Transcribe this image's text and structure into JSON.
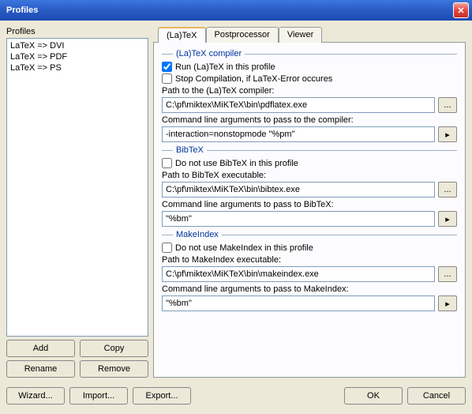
{
  "window": {
    "title": "Profiles"
  },
  "sidebar": {
    "label": "Profiles",
    "items": [
      "LaTeX => DVI",
      "LaTeX => PDF",
      "LaTeX => PS"
    ],
    "buttons": {
      "add": "Add",
      "copy": "Copy",
      "rename": "Rename",
      "remove": "Remove"
    }
  },
  "tabs": {
    "latex": "(La)TeX",
    "postprocessor": "Postprocessor",
    "viewer": "Viewer"
  },
  "latex_group": {
    "heading": "(La)TeX compiler",
    "run_chk": "Run (La)TeX in this profile",
    "run_checked": true,
    "stop_chk": "Stop Compilation, if LaTeX-Error occures",
    "stop_checked": false,
    "path_lbl": "Path to the (La)TeX compiler:",
    "path_val": "C:\\pf\\miktex\\MiKTeX\\bin\\pdflatex.exe",
    "args_lbl": "Command line arguments to pass to the compiler:",
    "args_val": "-interaction=nonstopmode \"%pm\""
  },
  "bibtex_group": {
    "heading": "BibTeX",
    "dont_chk": "Do not use BibTeX in this profile",
    "dont_checked": false,
    "path_lbl": "Path to BibTeX executable:",
    "path_val": "C:\\pf\\miktex\\MiKTeX\\bin\\bibtex.exe",
    "args_lbl": "Command line arguments to pass to BibTeX:",
    "args_val": "\"%bm\""
  },
  "makeindex_group": {
    "heading": "MakeIndex",
    "dont_chk": "Do not use MakeIndex in this profile",
    "dont_checked": false,
    "path_lbl": "Path to MakeIndex executable:",
    "path_val": "C:\\pf\\miktex\\MiKTeX\\bin\\makeindex.exe",
    "args_lbl": "Command line arguments to pass to MakeIndex:",
    "args_val": "\"%bm\""
  },
  "bottom": {
    "wizard": "Wizard...",
    "import": "Import...",
    "export": "Export...",
    "ok": "OK",
    "cancel": "Cancel"
  },
  "glyphs": {
    "browse": "...",
    "play": "▸"
  }
}
